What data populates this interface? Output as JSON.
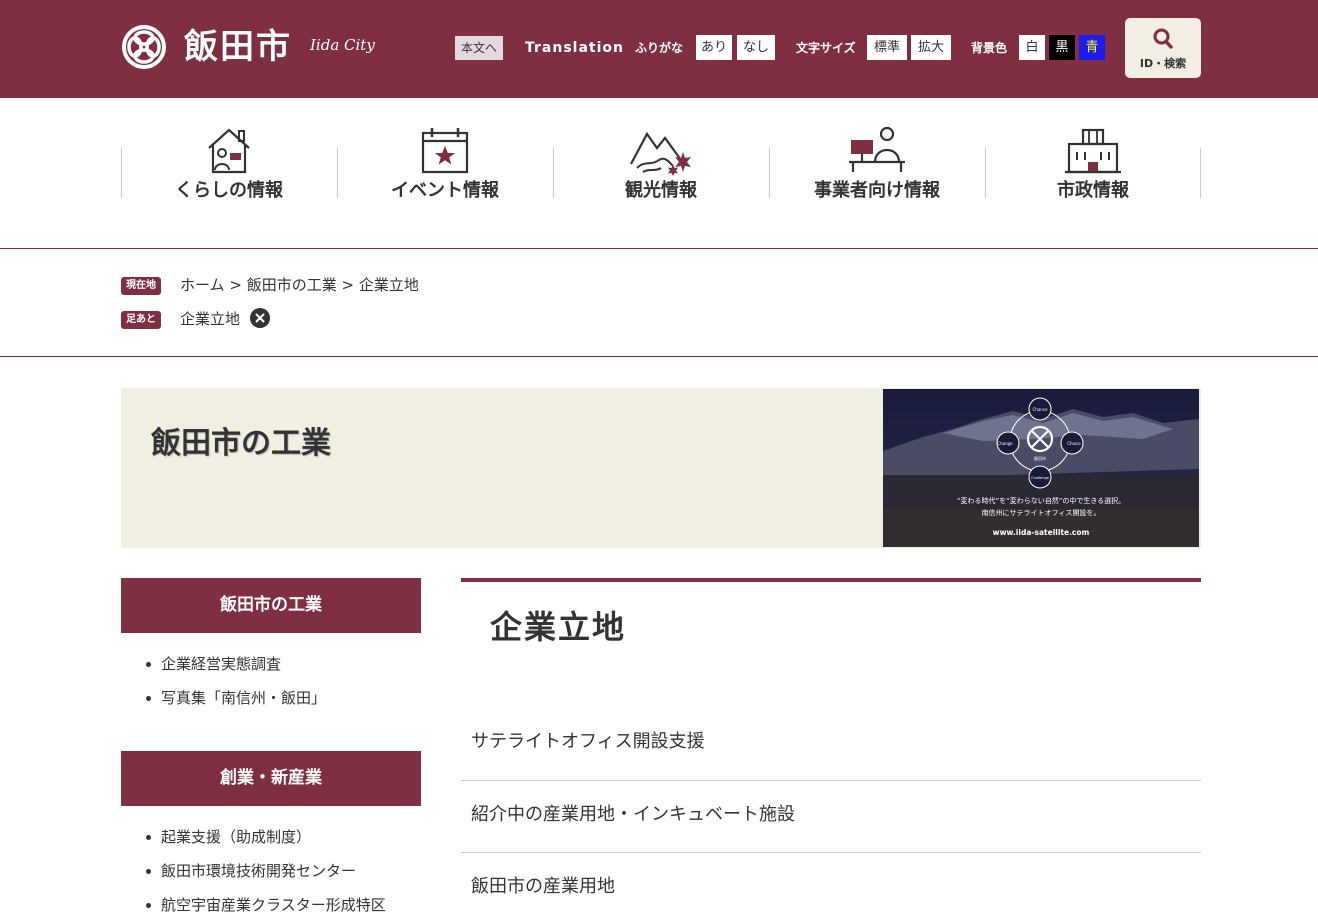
{
  "header": {
    "site_name": "飯田市",
    "site_name_en": "Iida City",
    "skip_link": "本文へ",
    "translation": "Translation",
    "furigana": {
      "label": "ふりがな",
      "on": "あり",
      "off": "なし"
    },
    "font_size": {
      "label": "文字サイズ",
      "standard": "標準",
      "large": "拡大"
    },
    "bg_color": {
      "label": "背景色",
      "white": "白",
      "black": "黒",
      "blue": "青"
    },
    "search_label": "ID・検索"
  },
  "gnav": [
    {
      "label": "くらしの情報",
      "icon": "house-person-icon"
    },
    {
      "label": "イベント情報",
      "icon": "calendar-star-icon"
    },
    {
      "label": "観光情報",
      "icon": "mountain-maple-icon"
    },
    {
      "label": "事業者向け情報",
      "icon": "business-person-icon"
    },
    {
      "label": "市政情報",
      "icon": "city-hall-icon"
    }
  ],
  "breadcrumb": {
    "current_badge": "現在地",
    "items": [
      "ホーム",
      "飯田市の工業",
      "企業立地"
    ],
    "separator": ">",
    "history_badge": "足あと",
    "history_item": "企業立地"
  },
  "banner": {
    "title": "飯田市の工業",
    "image": {
      "words": [
        "Chance",
        "Change",
        "Choice",
        "Challenge"
      ],
      "center": "飯田市",
      "copy1": "“変わる時代”を“変わらない自然”の中で生きる選択。",
      "copy2": "南信州にサテライトオフィス開設を。",
      "url": "www.iida-satellite.com"
    }
  },
  "sidebar": [
    {
      "heading": "飯田市の工業",
      "items": [
        "企業経営実態調査",
        "写真集「南信州・飯田」"
      ]
    },
    {
      "heading": "創業・新産業",
      "items": [
        "起業支援（助成制度）",
        "飯田市環境技術開発センター",
        "航空宇宙産業クラスター形成特区"
      ]
    }
  ],
  "main": {
    "title": "企業立地",
    "links": [
      "サテライトオフィス開設支援",
      "紹介中の産業用地・インキュベート施設",
      "飯田市の産業用地"
    ]
  },
  "colors": {
    "brand": "#7f2f41",
    "banner_bg": "#f1efe2",
    "search_bg": "#f2eee4"
  }
}
